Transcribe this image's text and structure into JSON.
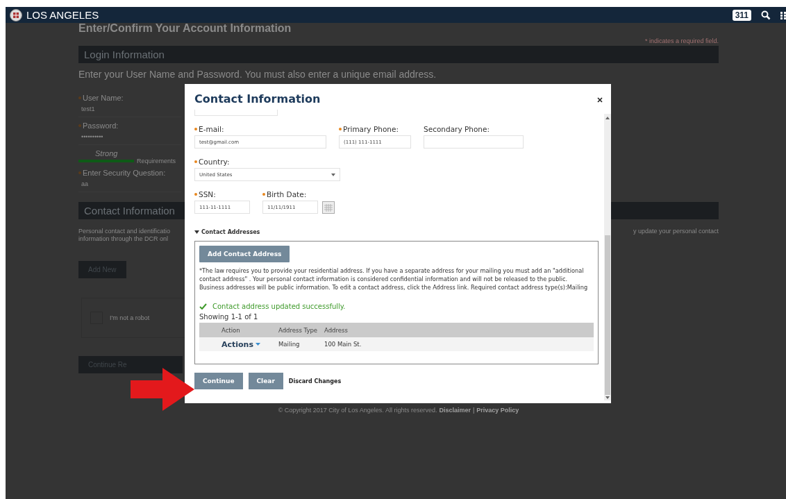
{
  "header": {
    "title": "LOS ANGELES",
    "badge": "311"
  },
  "page": {
    "title": "Enter/Confirm Your Account Information",
    "required_note": "* indicates a required field.",
    "login_section": {
      "title": "Login Information",
      "intro": "Enter your User Name and Password. You must also enter a unique email address.",
      "fields": [
        {
          "label": "User Name:",
          "value": "test1",
          "required": true
        },
        {
          "label": "Password:",
          "value": "••••••••••",
          "required": true
        }
      ],
      "strength": {
        "label": "Strong",
        "level": 1,
        "note": "Requirements"
      },
      "security": {
        "label": "Enter Security Question:",
        "value": "aa",
        "required": true
      }
    },
    "contact_section": {
      "title": "Contact Information",
      "text_left": "Personal contact and identificatio information through the DCR onl",
      "text_right": "y update your personal contact",
      "add_button": "Add New",
      "captcha": {
        "label": "I'm not a robot",
        "checked": false
      },
      "continue_button": "Continue Re"
    },
    "footer": {
      "copyright": "© Copyright 2017 City of Los Angeles. All rights reserved.",
      "links": [
        "Disclaimer",
        "Privacy Policy"
      ],
      "separator": "|"
    }
  },
  "modal": {
    "title": "Contact Information",
    "field_rows": [
      [
        {
          "label": "E-mail:",
          "value": "test@gmail.com",
          "required": true,
          "kind": "text"
        },
        {
          "label": "Primary Phone:",
          "value": "(111) 111-1111",
          "required": true,
          "kind": "text"
        },
        {
          "label": "Secondary Phone:",
          "required": false,
          "kind": "text"
        }
      ],
      [
        {
          "label": "Country:",
          "value": "United States",
          "required": true,
          "kind": "select"
        }
      ],
      [
        {
          "label": "SSN:",
          "value": "111-11-1111",
          "required": true,
          "kind": "text"
        },
        {
          "label": "Birth Date:",
          "value": "11/11/1911",
          "required": true,
          "kind": "date"
        }
      ]
    ],
    "addresses": {
      "title": "Contact Addresses",
      "expanded": true,
      "add_button": "Add Contact Address",
      "note": "*The law requires you to provide your residential address. If you have a separate address for your mailing you must add an \"additional contact address\" . Your personal contact information is considered confidential information and will not be released to the public. Business addresses will be public information. To edit a contact address, click the Address link. Required contact address type(s):Mailing",
      "message": {
        "kind": "success",
        "text": "Contact address updated successfully."
      },
      "showing": "Showing 1-1 of 1",
      "columns": [
        "Action",
        "Address Type",
        "Address"
      ],
      "rows": [
        {
          "action": "Actions",
          "type": "Mailing",
          "address": "100 Main St."
        }
      ]
    },
    "buttons": [
      {
        "label": "Continue",
        "kind": "button"
      },
      {
        "label": "Clear",
        "kind": "button"
      },
      {
        "label": "Discard Changes",
        "kind": "link"
      }
    ]
  }
}
